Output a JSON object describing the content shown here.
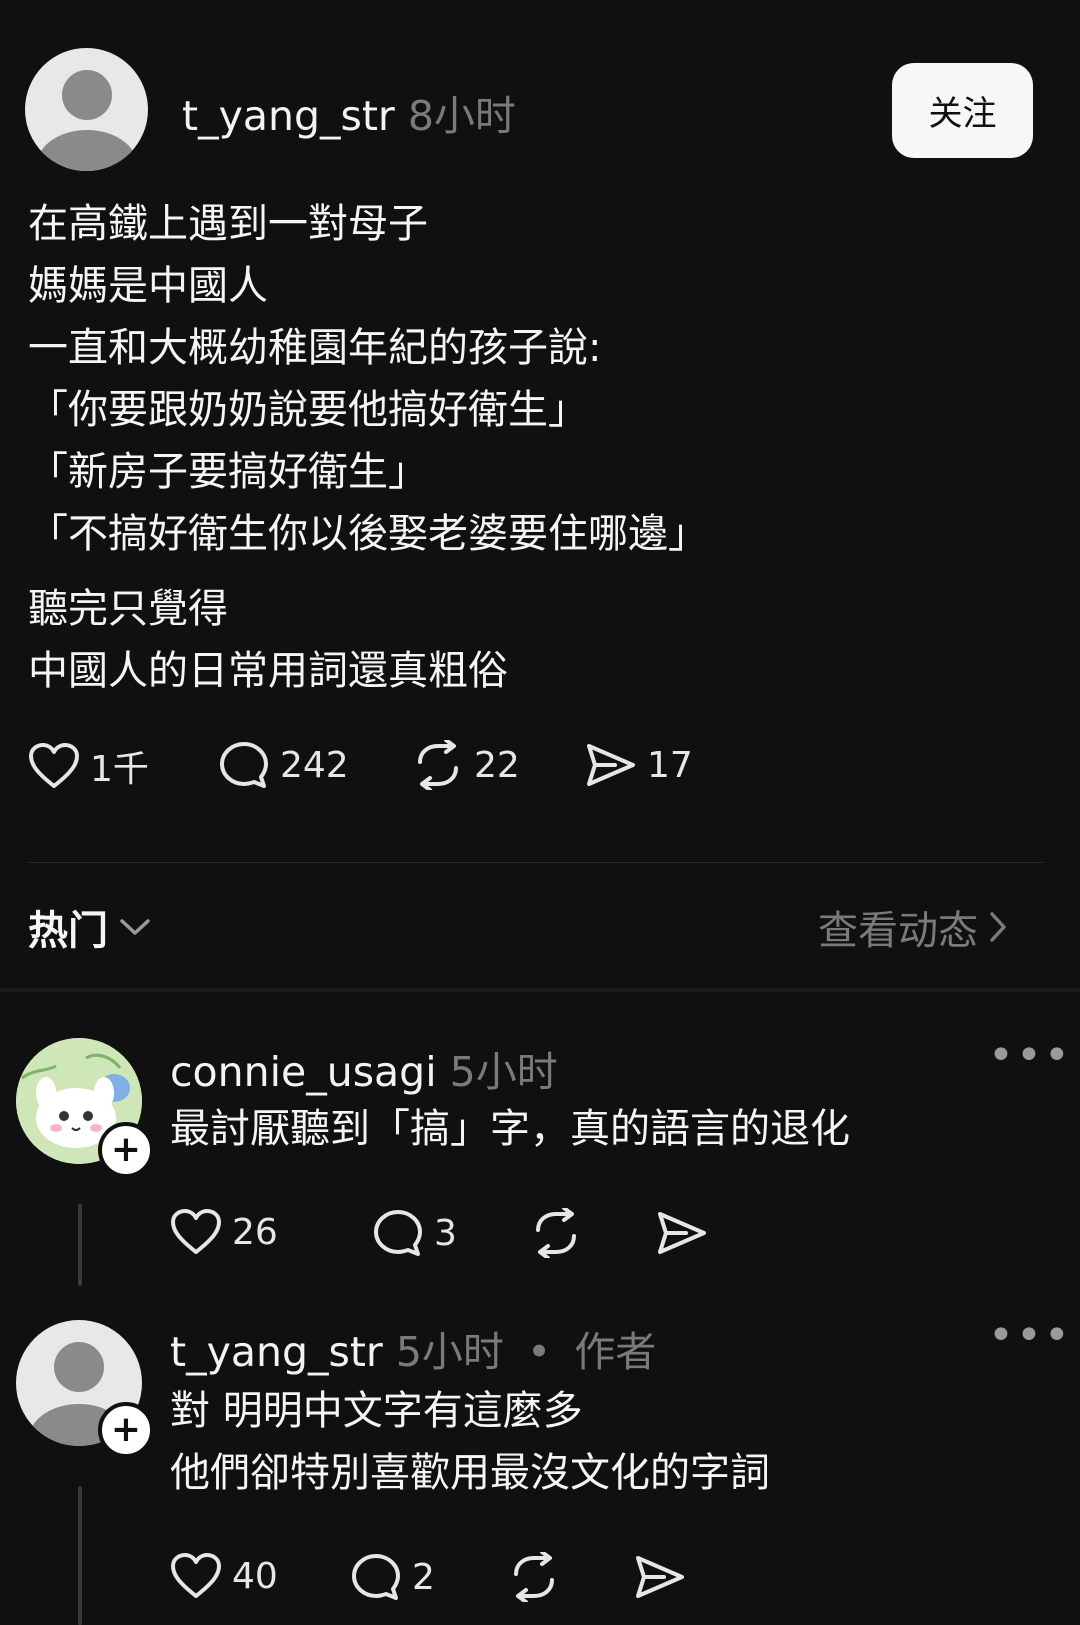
{
  "post": {
    "author": "t_yang_str",
    "time": "8小时",
    "follow_label": "关注",
    "body_lines_1": "在高鐵上遇到一對母子\n媽媽是中國人\n一直和大概幼稚園年紀的孩子說:\n「你要跟奶奶說要他搞好衛生」\n「新房子要搞好衛生」\n「不搞好衛生你以後娶老婆要住哪邊」",
    "body_lines_2": "聽完只覺得\n中國人的日常用詞還真粗俗",
    "likes": "1千",
    "comments": "242",
    "reposts": "22",
    "shares": "17"
  },
  "replies_header": {
    "sort_label": "热门",
    "view_activity": "查看动态"
  },
  "replies": [
    {
      "author": "connie_usagi",
      "time": "5小时",
      "text": "最討厭聽到「搞」字，真的語言的退化",
      "likes": "26",
      "comments": "3"
    },
    {
      "author": "t_yang_str",
      "time": "5小时",
      "badge": "作者",
      "text": "對 明明中文字有這麼多\n他們卻特別喜歡用最沒文化的字詞",
      "likes": "40",
      "comments": "2"
    }
  ]
}
